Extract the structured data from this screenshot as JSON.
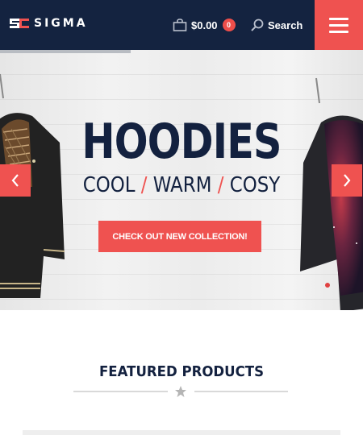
{
  "header": {
    "brand": "SIGMA",
    "cart_total": "$0.00",
    "cart_count": "0",
    "search_label": "Search"
  },
  "hero": {
    "title": "HOODIES",
    "subtitle_parts": [
      "COOL",
      "/",
      "WARM",
      "/",
      "COSY"
    ],
    "cta_label": "CHECK OUT NEW COLLECTION!",
    "slide_progress": 0.36
  },
  "featured": {
    "title": "FEATURED PRODUCTS"
  },
  "icons": {
    "cart": "shopping-bag-icon",
    "search": "magnifier-icon",
    "menu": "hamburger-icon",
    "prev": "chevron-left-icon",
    "next": "chevron-right-icon",
    "divider": "star-icon"
  },
  "colors": {
    "navy": "#142340",
    "accent": "#ef5250"
  }
}
